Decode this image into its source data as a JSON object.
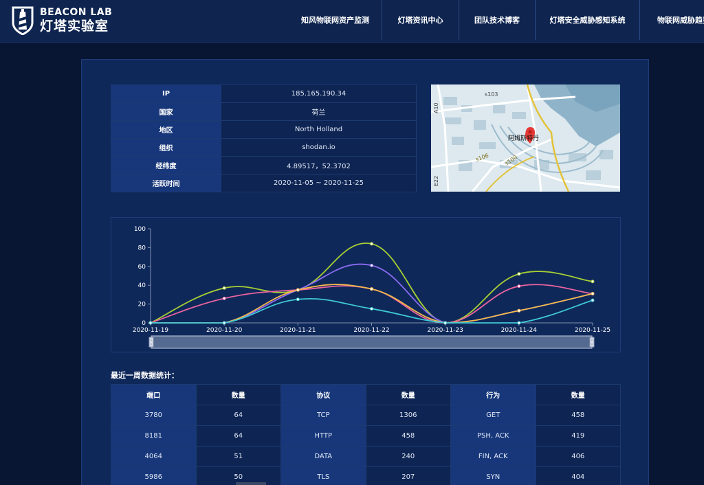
{
  "brand": {
    "en": "BEACON LAB",
    "cn": "灯塔实验室"
  },
  "nav": [
    "知风物联网资产监测",
    "灯塔资讯中心",
    "团队技术博客",
    "灯塔安全威胁感知系统",
    "物联网威胁趋势"
  ],
  "info": [
    {
      "key": "IP",
      "value": "185.165.190.34"
    },
    {
      "key": "国家",
      "value": "荷兰"
    },
    {
      "key": "地区",
      "value": "North Holland"
    },
    {
      "key": "组织",
      "value": "shodan.io"
    },
    {
      "key": "经纬度",
      "value": "4.89517，52.3702"
    },
    {
      "key": "活跃时间",
      "value": "2020-11-05 ~ 2020-11-25"
    }
  ],
  "map": {
    "label": "阿姆斯特丹",
    "roads": [
      "s103",
      "s106",
      "s100",
      "A10",
      "E22"
    ]
  },
  "chart_data": {
    "type": "line",
    "categories": [
      "2020-11-19",
      "2020-11-20",
      "2020-11-21",
      "2020-11-22",
      "2020-11-23",
      "2020-11-24",
      "2020-11-25"
    ],
    "ylim": [
      0,
      100
    ],
    "yticks": [
      0,
      20,
      40,
      60,
      80,
      100
    ],
    "grid": false,
    "legend": "none",
    "series": [
      {
        "color": "#a6cf33",
        "values": [
          0,
          37,
          35,
          84,
          0,
          52,
          44
        ]
      },
      {
        "color": "#e9639f",
        "values": [
          0,
          26,
          35,
          36,
          0,
          39,
          31
        ]
      },
      {
        "color": "#8b6cf2",
        "values": [
          0,
          0,
          35,
          61,
          0,
          13,
          31
        ]
      },
      {
        "color": "#f2b84b",
        "values": [
          0,
          0,
          35,
          36,
          0,
          13,
          31
        ]
      },
      {
        "color": "#3ec9d6",
        "values": [
          0,
          0,
          25,
          15,
          0,
          0,
          24
        ]
      }
    ]
  },
  "stats": {
    "title": "最近一周数据统计：",
    "headers": [
      "端口",
      "数量",
      "协议",
      "数量",
      "行为",
      "数量"
    ],
    "rows": [
      [
        "3780",
        "64",
        "TCP",
        "1306",
        "GET",
        "458"
      ],
      [
        "8181",
        "64",
        "HTTP",
        "458",
        "PSH, ACK",
        "419"
      ],
      [
        "4064",
        "51",
        "DATA",
        "240",
        "FIN, ACK",
        "406"
      ],
      [
        "5986",
        "50",
        "TLS",
        "207",
        "SYN",
        "404"
      ]
    ]
  },
  "colors": {
    "page_bg": "#081634",
    "header_bg": "#0f2550",
    "card_bg": "#0f285a",
    "cell_light": "#17377a",
    "cell_dark": "#0e2452"
  }
}
